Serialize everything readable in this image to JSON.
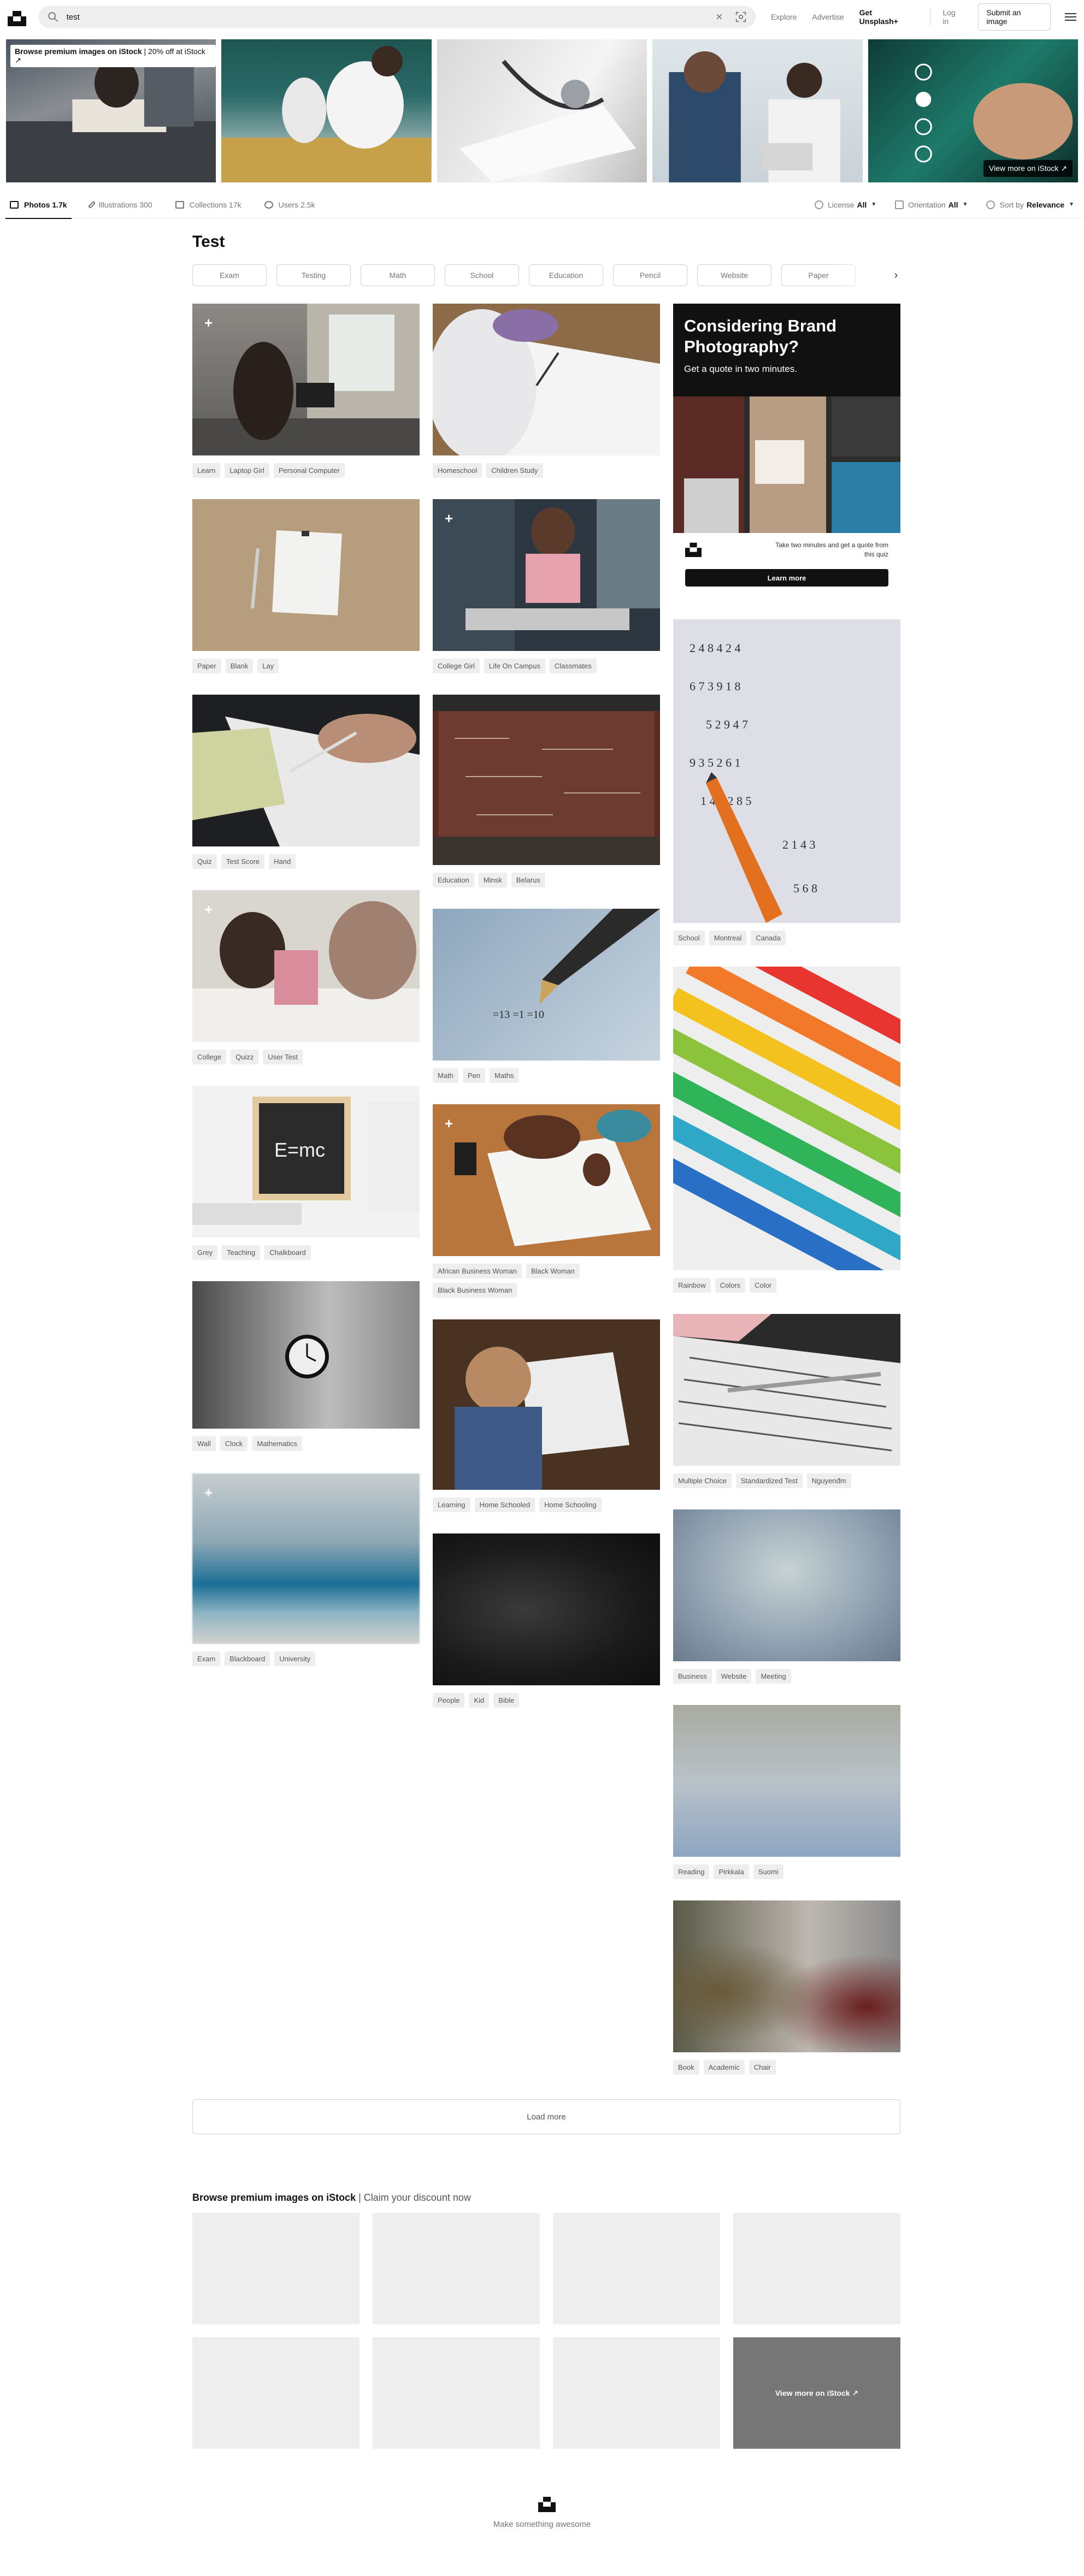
{
  "header": {
    "search_value": "test",
    "nav": [
      "Explore",
      "Advertise",
      "Get Unsplash+"
    ],
    "login": "Log in",
    "submit": "Submit an image"
  },
  "banner": {
    "badge_strong": "Browse premium images on iStock",
    "badge_rest": " | 20% off at iStock ↗",
    "more": "View more on iStock ↗"
  },
  "tabs": [
    {
      "label": "Photos",
      "count": "1.7k"
    },
    {
      "label": "Illustrations",
      "count": "300"
    },
    {
      "label": "Collections",
      "count": "17k"
    },
    {
      "label": "Users",
      "count": "2.5k"
    }
  ],
  "filters": {
    "license_label": "License",
    "license_value": "All",
    "orientation_label": "Orientation",
    "orientation_value": "All",
    "sort_label": "Sort by",
    "sort_value": "Relevance"
  },
  "page_title": "Test",
  "related": [
    "Exam",
    "Testing",
    "Math",
    "School",
    "Education",
    "Pencil",
    "Website",
    "Paper"
  ],
  "col1": [
    {
      "tags": [
        "Learn",
        "Laptop Girl",
        "Personal Computer"
      ]
    },
    {
      "tags": [
        "Paper",
        "Blank",
        "Lay"
      ]
    },
    {
      "tags": [
        "Quiz",
        "Test Score",
        "Hand"
      ]
    },
    {
      "tags": [
        "College",
        "Quizz",
        "User Test"
      ]
    },
    {
      "tags": [
        "Grey",
        "Teaching",
        "Chalkboard"
      ]
    },
    {
      "tags": [
        "Wall",
        "Clock",
        "Mathematics"
      ]
    },
    {
      "tags": [
        "Exam",
        "Blackboard",
        "University"
      ]
    }
  ],
  "col2": [
    {
      "tags": [
        "Homeschool",
        "Children Study"
      ]
    },
    {
      "tags": [
        "College Girl",
        "Life On Campus",
        "Classmates"
      ]
    },
    {
      "tags": [
        "Education",
        "Minsk",
        "Belarus"
      ]
    },
    {
      "tags": [
        "Math",
        "Pen",
        "Maths"
      ]
    },
    {
      "tags": [
        "African Business Woman",
        "Black Woman",
        "Black Business Woman"
      ]
    },
    {
      "tags": [
        "Learning",
        "Home Schooled",
        "Home Schooling"
      ]
    },
    {
      "tags": [
        "People",
        "Kid",
        "Bible"
      ]
    }
  ],
  "col3": [
    {
      "tags": [
        "School",
        "Montreal",
        "Canada"
      ]
    },
    {
      "tags": [
        "Rainbow",
        "Colors",
        "Color"
      ]
    },
    {
      "tags": [
        "Multiple Choice",
        "Standardized Test",
        "Nguyenđm"
      ]
    },
    {
      "tags": [
        "Business",
        "Website",
        "Meeting"
      ]
    },
    {
      "tags": [
        "Reading",
        "Pirkkala",
        "Suomi"
      ]
    },
    {
      "tags": [
        "Book",
        "Academic",
        "Chair"
      ]
    }
  ],
  "ad": {
    "heading": "Considering Brand Photography?",
    "sub": "Get a quote in two minutes.",
    "foot": "Take two minutes and get a quote from this quiz",
    "button": "Learn more"
  },
  "load_more": "Load more",
  "istock": {
    "title_strong": "Browse premium images on iStock",
    "title_rest": " | Claim your discount now",
    "more": "View more on iStock ↗"
  },
  "footer": "Make something awesome"
}
